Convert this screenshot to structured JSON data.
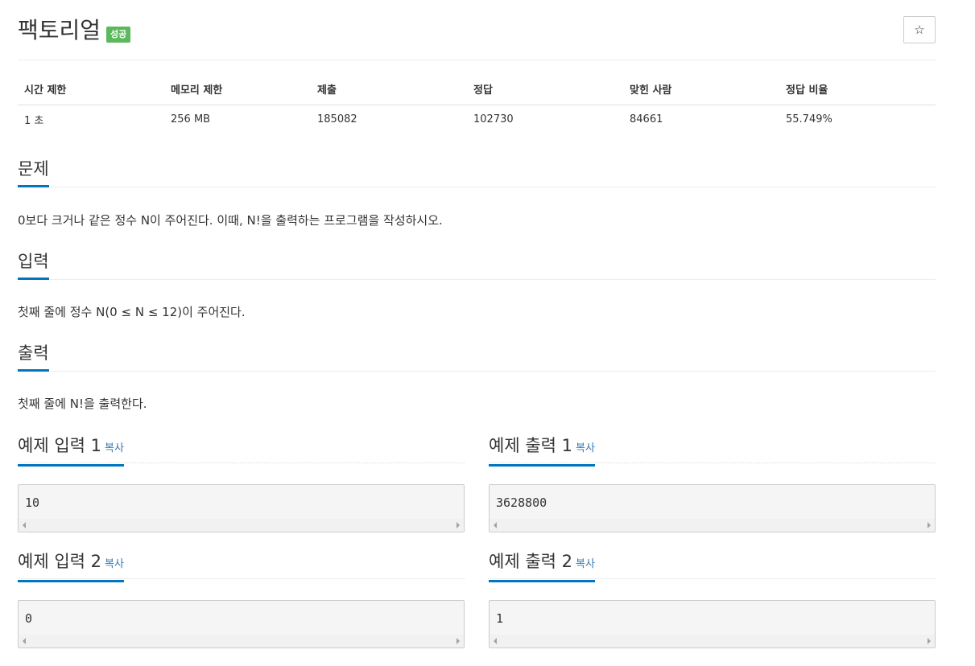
{
  "problem": {
    "title": "팩토리얼",
    "badge": "성공",
    "star_icon": "☆"
  },
  "info_table": {
    "headers": [
      "시간 제한",
      "메모리 제한",
      "제출",
      "정답",
      "맞힌 사람",
      "정답 비율"
    ],
    "values": [
      "1 초",
      "256 MB",
      "185082",
      "102730",
      "84661",
      "55.749%"
    ]
  },
  "sections": {
    "description": {
      "heading": "문제",
      "text": "0보다 크거나 같은 정수 N이 주어진다. 이때, N!을 출력하는 프로그램을 작성하시오."
    },
    "input": {
      "heading": "입력",
      "text": "첫째 줄에 정수 N(0 ≤ N ≤ 12)이 주어진다."
    },
    "output": {
      "heading": "출력",
      "text": "첫째 줄에 N!을 출력한다."
    }
  },
  "samples": {
    "copy_label": "복사",
    "input1": {
      "heading": "예제 입력 1",
      "value": "10"
    },
    "output1": {
      "heading": "예제 출력 1",
      "value": "3628800"
    },
    "input2": {
      "heading": "예제 입력 2",
      "value": "0"
    },
    "output2": {
      "heading": "예제 출력 2",
      "value": "1"
    }
  },
  "colors": {
    "accent": "#0076c0",
    "success_badge": "#5cb85c",
    "link": "#337ab7"
  }
}
